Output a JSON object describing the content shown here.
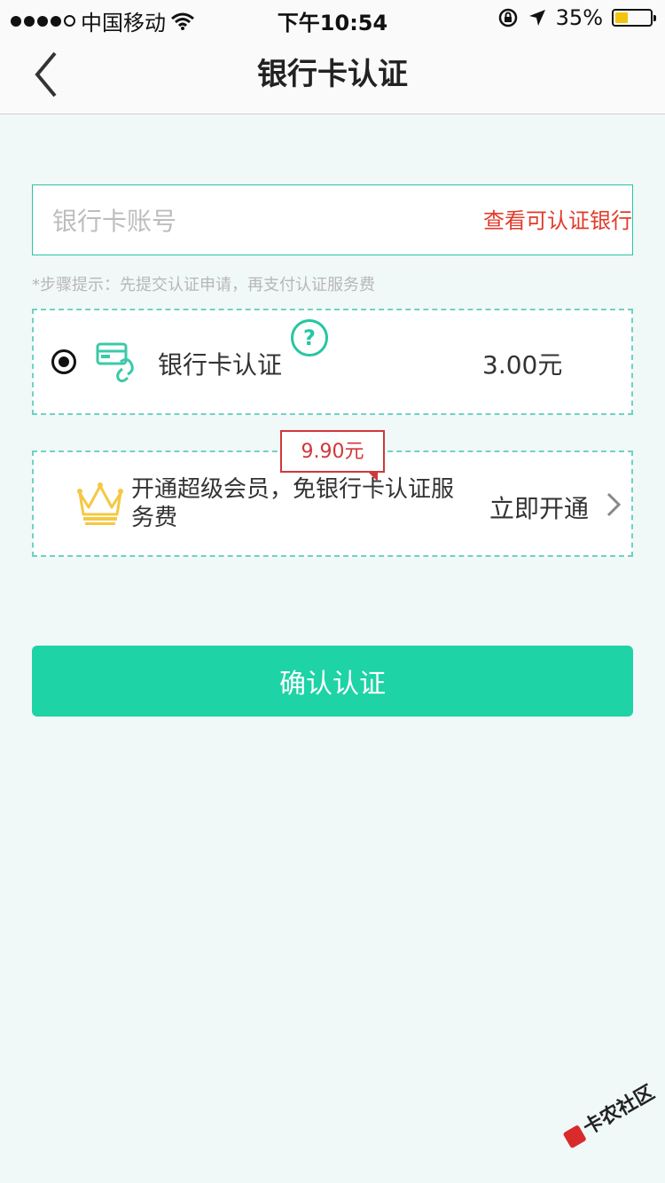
{
  "status_bar": {
    "carrier": "中国移动",
    "time": "下午10:54",
    "battery": "35%",
    "battery_level": 0.35
  },
  "nav": {
    "title": "银行卡认证"
  },
  "card_input": {
    "placeholder": "银行卡账号",
    "value": "",
    "view_banks_link": "查看可认证银行"
  },
  "hint": "*步骤提示：先提交认证申请，再支付认证服务费",
  "option": {
    "label": "银行卡认证",
    "price": "3.00元",
    "selected": true
  },
  "vip": {
    "tag_price": "9.90元",
    "description": "开通超级会员，免银行卡认证服务费",
    "action": "立即开通"
  },
  "confirm_button": "确认认证",
  "watermark": "卡农社区",
  "colors": {
    "accent": "#1ed3a5",
    "border_teal": "#27c5a3",
    "link_red": "#e23b2a",
    "crown_gold": "#f5c842"
  }
}
